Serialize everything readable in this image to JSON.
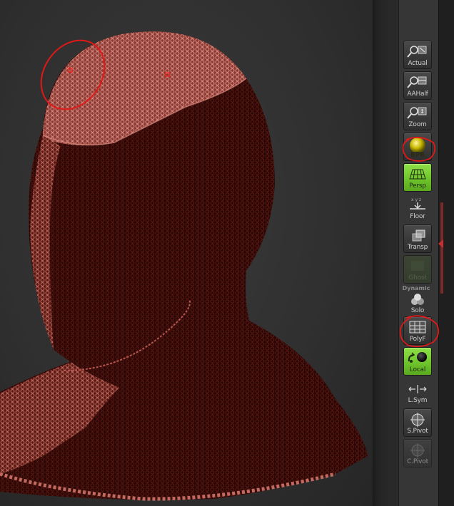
{
  "viewport": {
    "model": "chainmail coif",
    "colors": {
      "mesh": "#b5564e",
      "mesh_dark": "#3a0b08",
      "background": "#303030"
    }
  },
  "toolbar": {
    "dynamic_label": "Dynamic",
    "buttons": [
      {
        "id": "actual",
        "label": "Actual",
        "icon": "magnifier-actual-icon",
        "state": "normal"
      },
      {
        "id": "aahalf",
        "label": "AAHalf",
        "icon": "magnifier-aahalf-icon",
        "state": "normal"
      },
      {
        "id": "zoom",
        "label": "Zoom",
        "icon": "magnifier-zoom-icon",
        "state": "normal"
      },
      {
        "id": "bpr",
        "label": "BPR",
        "icon": "sphere-render-icon",
        "state": "normal"
      },
      {
        "id": "persp",
        "label": "Persp",
        "icon": "perspective-grid-icon",
        "state": "active"
      },
      {
        "id": "floor",
        "label": "Floor",
        "icon": "floor-grid-icon",
        "state": "flat"
      },
      {
        "id": "transp",
        "label": "Transp",
        "icon": "transparency-icon",
        "state": "normal"
      },
      {
        "id": "ghost",
        "label": "Ghost",
        "icon": "ghost-icon",
        "state": "disabled"
      },
      {
        "id": "solo",
        "label": "Solo",
        "icon": "solo-spheres-icon",
        "state": "flat"
      },
      {
        "id": "polyf",
        "label": "PolyF",
        "icon": "polyframe-grid-icon",
        "state": "normal"
      },
      {
        "id": "local",
        "label": "Local",
        "icon": "local-rotation-icon",
        "state": "active"
      },
      {
        "id": "lsym",
        "label": "L.Sym",
        "icon": "local-symmetry-icon",
        "state": "flat"
      },
      {
        "id": "spivot",
        "label": "S.Pivot",
        "icon": "pivot-icon",
        "state": "normal"
      },
      {
        "id": "cpivot",
        "label": "C.Pivot",
        "icon": "pivot-disabled-icon",
        "state": "disabled"
      }
    ]
  },
  "annotations": {
    "color": "#e01818",
    "marks": [
      "viewport-head-circle",
      "bpr-circle",
      "polyf-circle"
    ]
  }
}
